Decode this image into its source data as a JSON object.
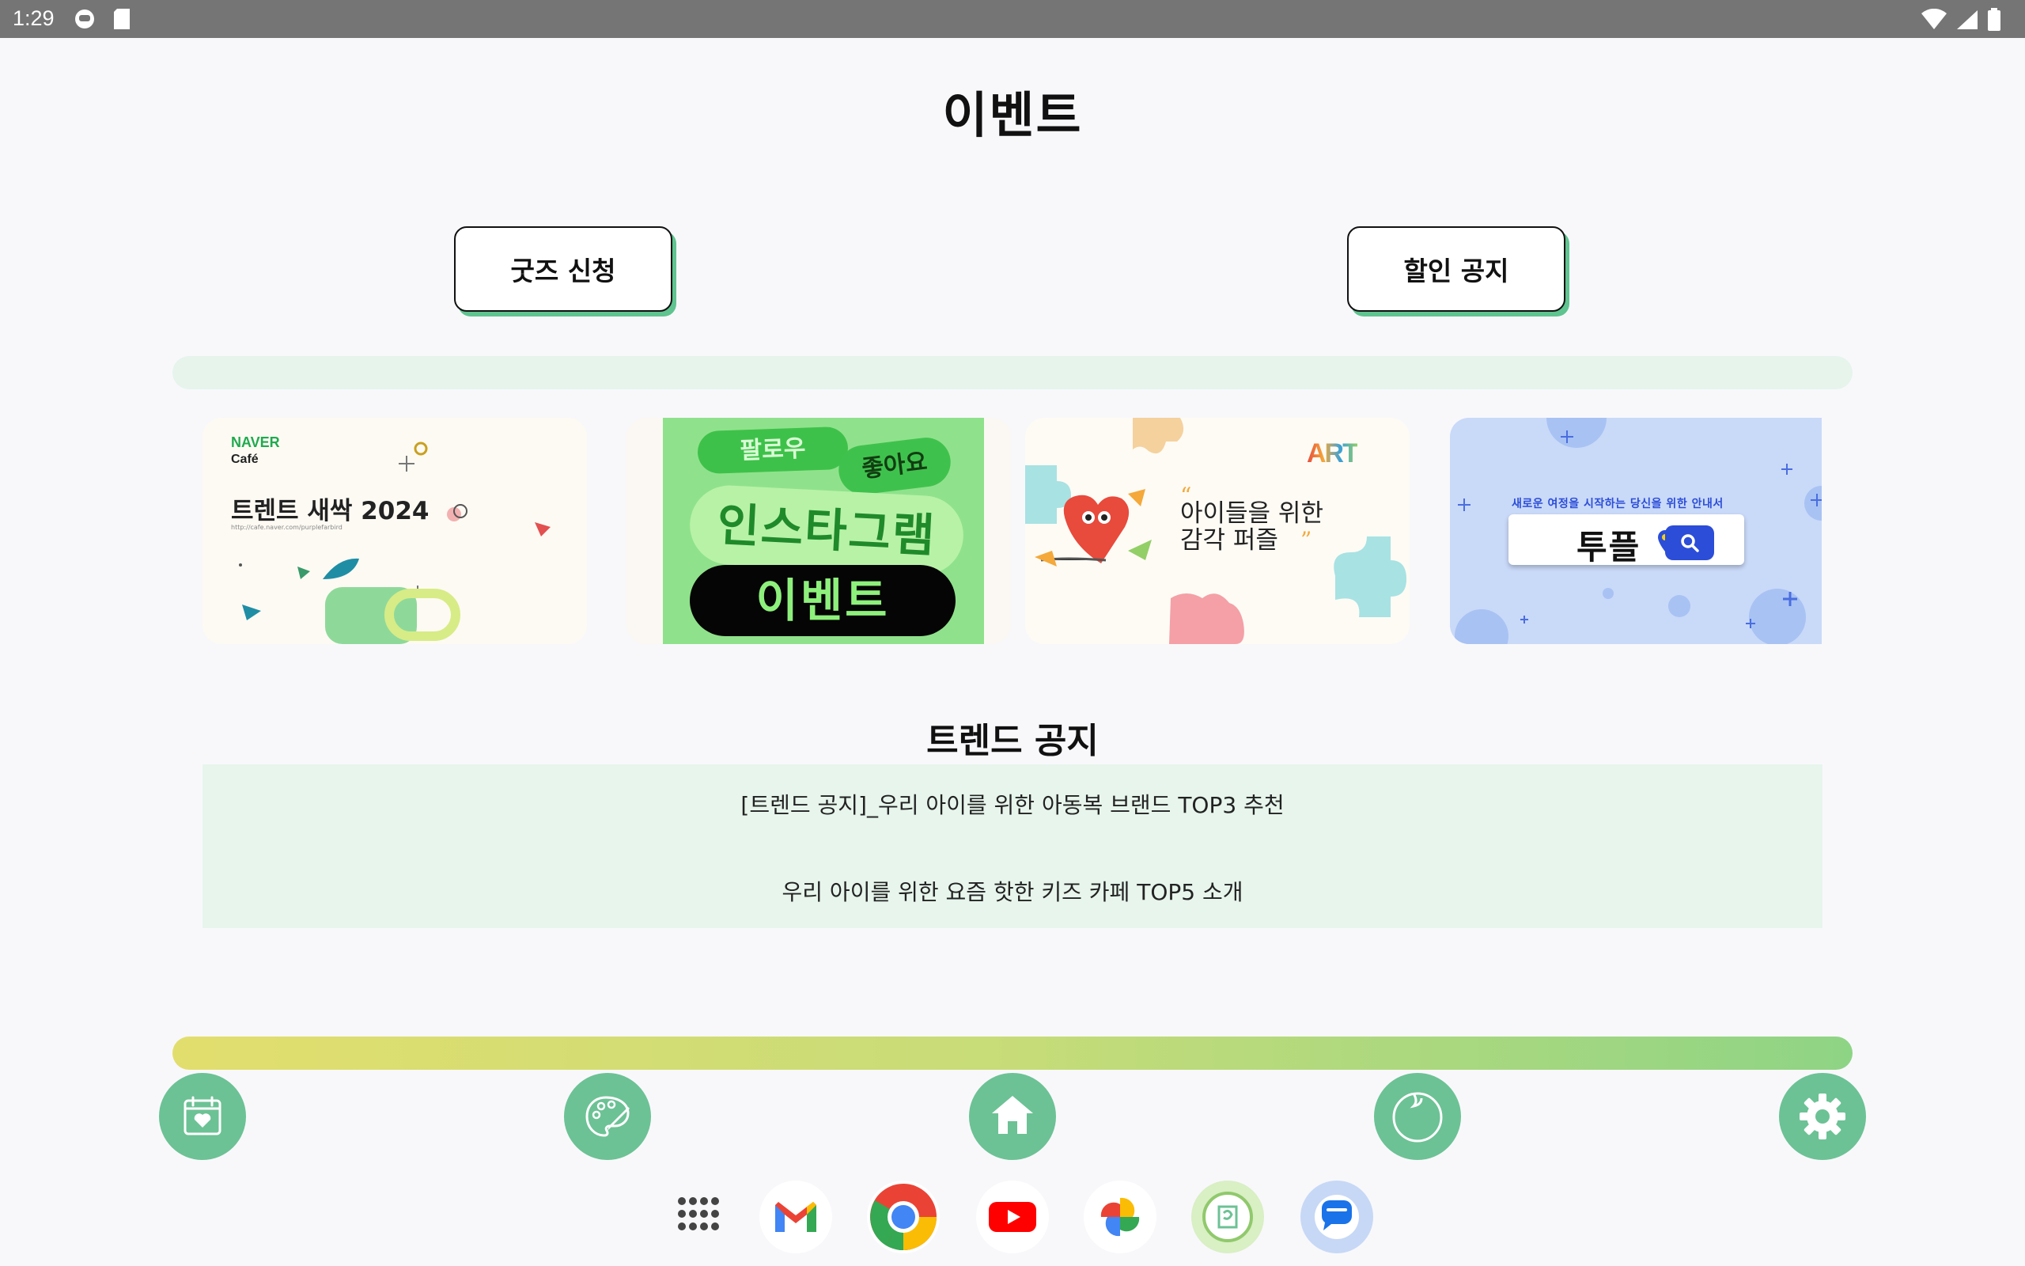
{
  "status_bar": {
    "time": "1:29"
  },
  "page": {
    "title": "이벤트"
  },
  "buttons": {
    "goods": "굿즈 신청",
    "sale": "할인 공지"
  },
  "cards": {
    "naver": {
      "brand": "NAVER",
      "sub": "Café",
      "title": "트렌트 새싹 2024",
      "url": "http://cafe.naver.com/purplefarbird"
    },
    "insta": {
      "follow": "팔로우",
      "like": "좋아요",
      "name": "인스타그램",
      "event": "이벤트"
    },
    "puzzle": {
      "art": "ART",
      "line1": "아이들을 위한",
      "line2": "감각 퍼즐"
    },
    "tuple": {
      "tagline": "새로운 여정을 시작하는 당신을 위한 안내서",
      "name": "투플"
    }
  },
  "notice": {
    "title": "트렌드 공지",
    "items": [
      "[트렌드 공지]_우리 아이를 위한 아동복 브랜드 TOP3 추천",
      "우리 아이를 위한 요즘 핫한 키즈 카페 TOP5 소개"
    ]
  },
  "nav": [
    "calendar-heart-icon",
    "palette-icon",
    "home-icon",
    "baby-face-icon",
    "settings-gear-icon"
  ],
  "dock": [
    "app-drawer",
    "gmail",
    "chrome",
    "youtube",
    "photos",
    "app-custom",
    "messages"
  ],
  "colors": {
    "accent": "#6cc295",
    "band": "#e6f4ec",
    "notice_bg": "#e7f5ec"
  }
}
